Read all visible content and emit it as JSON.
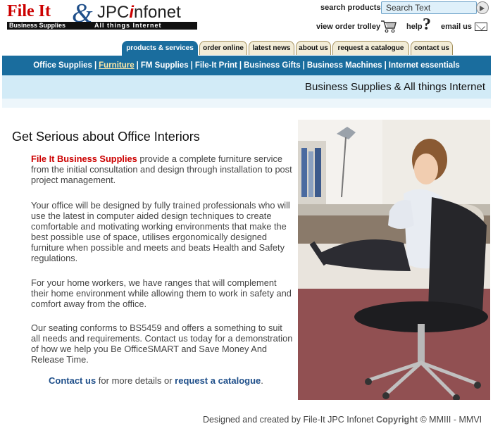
{
  "logo": {
    "name_left": "File It",
    "ampersand": "&",
    "name_right_pre": "JPC",
    "name_right_i": "i",
    "name_right_post": "nfonet",
    "tagline_left": "Business Supplies",
    "tagline_right": "All things Internet"
  },
  "header": {
    "search_label": "search products",
    "search_value": "Search Text",
    "trolley_label": "view order trolley",
    "help_label": "help",
    "help_glyph": "?",
    "email_label": "email us"
  },
  "tabs": [
    {
      "label": "products & services",
      "active": true
    },
    {
      "label": "order online",
      "active": false
    },
    {
      "label": "latest news",
      "active": false
    },
    {
      "label": "about us",
      "active": false
    },
    {
      "label": "request a catalogue",
      "active": false
    },
    {
      "label": "contact us",
      "active": false
    }
  ],
  "nav": {
    "items": [
      "Office Supplies",
      "Furniture",
      "FM Supplies",
      "File-It Print",
      "Business Gifts",
      "Business Machines",
      "Internet essentials"
    ],
    "separator": "|",
    "current": "Furniture"
  },
  "banner": {
    "text": "Business Supplies & All things Internet"
  },
  "main": {
    "title": "Get Serious about Office Interiors",
    "para1_brand": "File It Business Supplies",
    "para1_rest": " provide a complete furniture service from the initial consultation and design through installation to post project management.",
    "para2": "Your office will be designed by fully trained professionals who will use the latest in computer aided design techniques to create comfortable and motivating working environments that make the best possible use of space, utilises ergonomically designed furniture when possible and meets and beats Health and Safety regulations.",
    "para3": "For your home workers, we have ranges that will complement their home environment while allowing them to work in safety and comfort away from the office.",
    "para4": "Our seating conforms to BS5459 and offers a something to suit all needs and requirements. Contact us today for a demonstration of how we help you Be OfficeSMART and Save Money And Release Time.",
    "cta_link1": "Contact us",
    "cta_mid": " for more details or ",
    "cta_link2": "request a catalogue",
    "cta_end": "."
  },
  "footer": {
    "text": "Designed and created by File-It JPC Infonet ",
    "copyright_word": "Copyright",
    "copyright_rest": " © MMIII - MMVI"
  },
  "colors": {
    "brand_red": "#cc0000",
    "nav_blue": "#1a6d9e",
    "banner_light_blue": "#d2ebf7",
    "link_blue": "#1f4f8a",
    "tab_beige": "#f2ecd7"
  }
}
